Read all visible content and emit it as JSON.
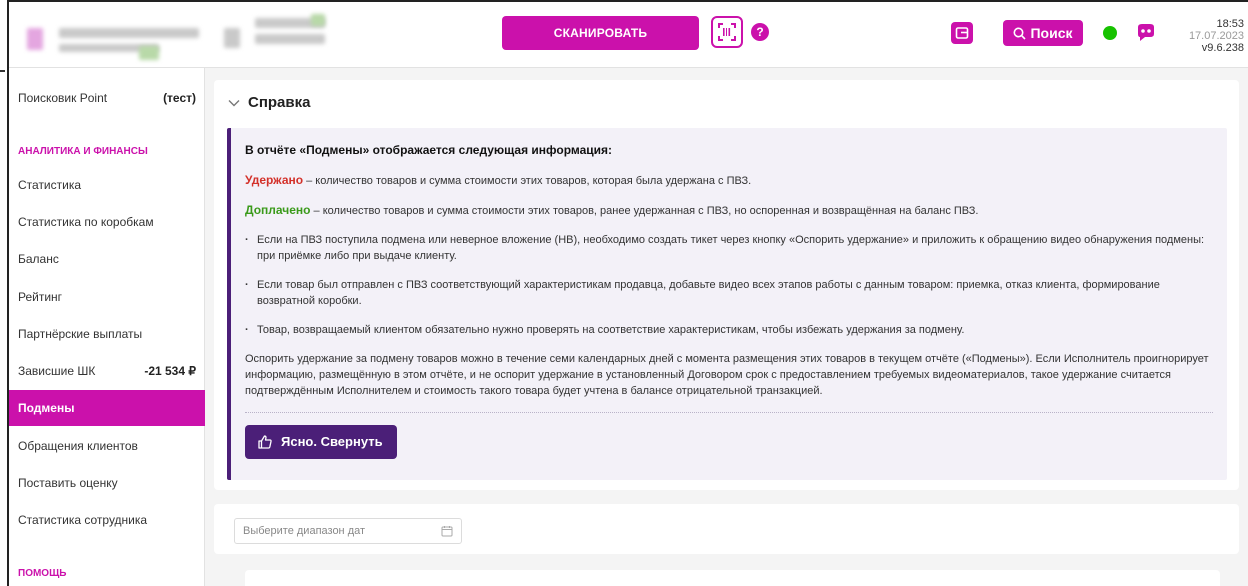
{
  "header": {
    "scan_label": "СКАНИРОВАТЬ",
    "help_label": "?",
    "search_label": "Поиск",
    "time": "18:53",
    "date": "17.07.2023",
    "version": "v9.6.238",
    "colors": {
      "brand": "#cb11ab",
      "online": "#17c200"
    }
  },
  "sidebar": {
    "top_item": {
      "label": "Поисковик Point",
      "badge": "(тест)"
    },
    "section_analytics": "АНАЛИТИКА И ФИНАНСЫ",
    "items": [
      {
        "label": "Статистика",
        "value": ""
      },
      {
        "label": "Статистика по коробкам",
        "value": ""
      },
      {
        "label": "Баланс",
        "value": ""
      },
      {
        "label": "Рейтинг",
        "value": ""
      },
      {
        "label": "Партнёрские выплаты",
        "value": ""
      },
      {
        "label": "Зависшие ШК",
        "value": "-21 534 ₽"
      },
      {
        "label": "Подмены",
        "value": ""
      },
      {
        "label": "Обращения клиентов",
        "value": ""
      },
      {
        "label": "Поставить оценку",
        "value": ""
      },
      {
        "label": "Статистика сотрудника",
        "value": ""
      }
    ],
    "section_help": "ПОМОЩЬ"
  },
  "reference": {
    "title": "Справка",
    "lead": "В отчёте «Подмены» отображается следующая информация:",
    "withheld_term": "Удержано",
    "withheld_text": " – количество товаров и сумма стоимости этих товаров, которая была удержана с ПВЗ.",
    "paid_term": "Доплачено",
    "paid_text": " – количество товаров и сумма стоимости этих товаров, ранее удержанная с ПВЗ, но оспоренная и возвращённая на баланс ПВЗ.",
    "bullet1": "Если на ПВЗ поступила подмена или неверное вложение (НВ), необходимо создать тикет через кнопку «Оспорить удержание» и приложить к обращению видео обнаружения подмены: при приёмке либо при выдаче клиенту.",
    "bullet2": "Если товар был отправлен с ПВЗ соответствующий характеристикам продавца, добавьте видео всех этапов работы с данным товаром: приемка, отказ клиента, формирование возвратной коробки.",
    "bullet3": "Товар, возвращаемый клиентом обязательно нужно проверять на соответствие характеристикам, чтобы избежать удержания за подмену.",
    "paragraph": "Оспорить удержание за подмену товаров можно в течение семи календарных дней с момента размещения этих товаров в текущем отчёте («Подмены»). Если Исполнитель проигнорирует информацию, размещённую в этом отчёте, и не оспорит удержание в установленный Договором срок с предоставлением требуемых видеоматериалов, такое удержание считается подтверждённым Исполнителем и стоимость такого товара будет учтена в балансе отрицательной транзакцией.",
    "collapse_label": "Ясно. Свернуть"
  },
  "filters": {
    "date_placeholder": "Выберите диапазон дат"
  }
}
